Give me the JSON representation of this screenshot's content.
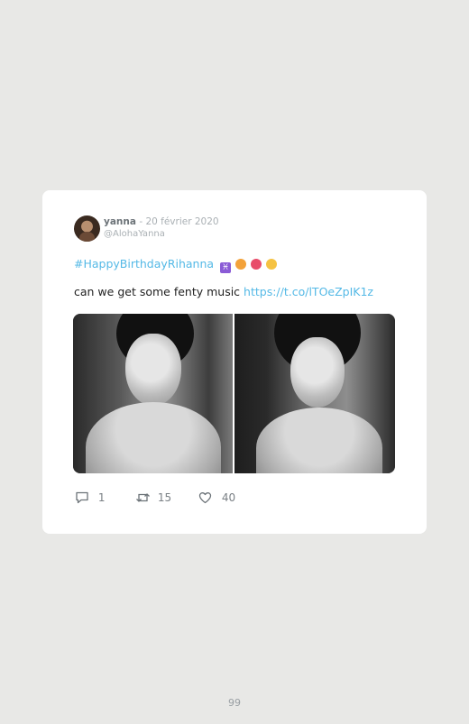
{
  "tweet": {
    "user_name": "yanna",
    "date": "- 20 février 2020",
    "handle": "@AlohaYanna",
    "hashtag": "#HappyBirthdayRihanna",
    "emoji_icons": [
      "pisces-icon",
      "heart-eyes-icon",
      "heart-icon",
      "party-face-icon"
    ],
    "pisces_glyph": "♓",
    "text": "can we get some fenty music",
    "link": "https://t.co/lTOeZpIK1z",
    "images": [
      "portrait-photo-left",
      "portrait-photo-right"
    ],
    "actions": {
      "reply_count": "1",
      "retweet_count": "15",
      "like_count": "40"
    }
  },
  "page_number": "99"
}
